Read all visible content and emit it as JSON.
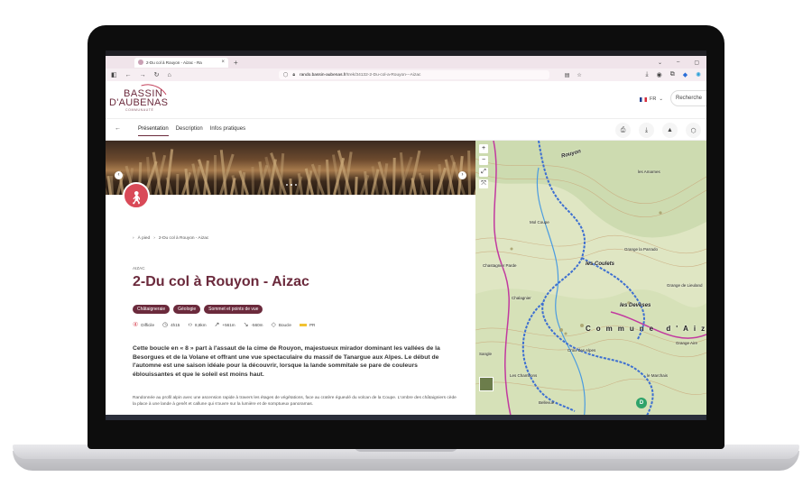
{
  "browser": {
    "tab_title": "2-Du col à Rouyon - Aizac - Ra",
    "url_host": "rando.bassin-aubenas.fr",
    "url_path": "/trek/34132-2-Du-col-a-Rouyon---Aizac"
  },
  "site": {
    "logo_line1": "BASSIN",
    "logo_line2": "D'AUBENAS",
    "logo_line3": "COMMUNAUTÉ",
    "lang": "FR",
    "search_label": "Recherche"
  },
  "nav": {
    "tabs": [
      "Présentation",
      "Description",
      "Infos pratiques"
    ]
  },
  "trek": {
    "breadcrumb_home": "À pied",
    "breadcrumb_current": "2-Du col à Rouyon - Aizac",
    "place": "AIZAC",
    "title": "2-Du col à Rouyon - Aizac",
    "tags": [
      "Châtaigneraie",
      "Géologie",
      "Sommet et points de vue"
    ],
    "difficulty": "Difficile",
    "duration": "4h15",
    "distance": "8,8km",
    "ascent": "+561m",
    "descent": "-560m",
    "loop": "Boucle",
    "marking": "PR",
    "lead": "Cette boucle en « 8 » part à l'assaut de la cime de Rouyon, majestueux mirador dominant les vallées de la Besorgues et de la Volane et offrant une vue spectaculaire du massif de Tanargue aux Alpes. Le début de l'automne est une saison idéale pour la découvrir, lorsque la lande sommitale se pare de couleurs éblouissantes et que le soleil est moins haut.",
    "body": "Randonnée au profil alpin avec une ascension rapide à travers les étages de végétations, face au cratère égueulé du volcan de la Coupe. L'ombre des châtaigniers cède la place à une lande à genêt et callune qui s'ouvre sur la lumière et de somptueux panoramas."
  },
  "map": {
    "labels": {
      "rouyon": "Rouyon",
      "amarnes": "les Amarnes",
      "col_coupe": "Mol Coupe",
      "chastagnier": "Chastagnier Parde",
      "grange_parrado": "Grange la Parrado",
      "coulets": "les Coulets",
      "grange_lieuland": "Grange de Lieuland",
      "chalagnier": "Chalagnier",
      "deveses": "les Devèses",
      "commune": "Commune d'Aiz",
      "croix": "Croix des Alpes",
      "grange_aire": "Grange Aire",
      "sangle": "Sangle",
      "chambon": "Les Chambons",
      "bellevue": "Bellevue",
      "marchais": "le Marchais"
    },
    "marker": "D"
  },
  "colors": {
    "brand": "#6b2a3c",
    "accent": "#d94a58",
    "trail": "#3d6fd1"
  }
}
